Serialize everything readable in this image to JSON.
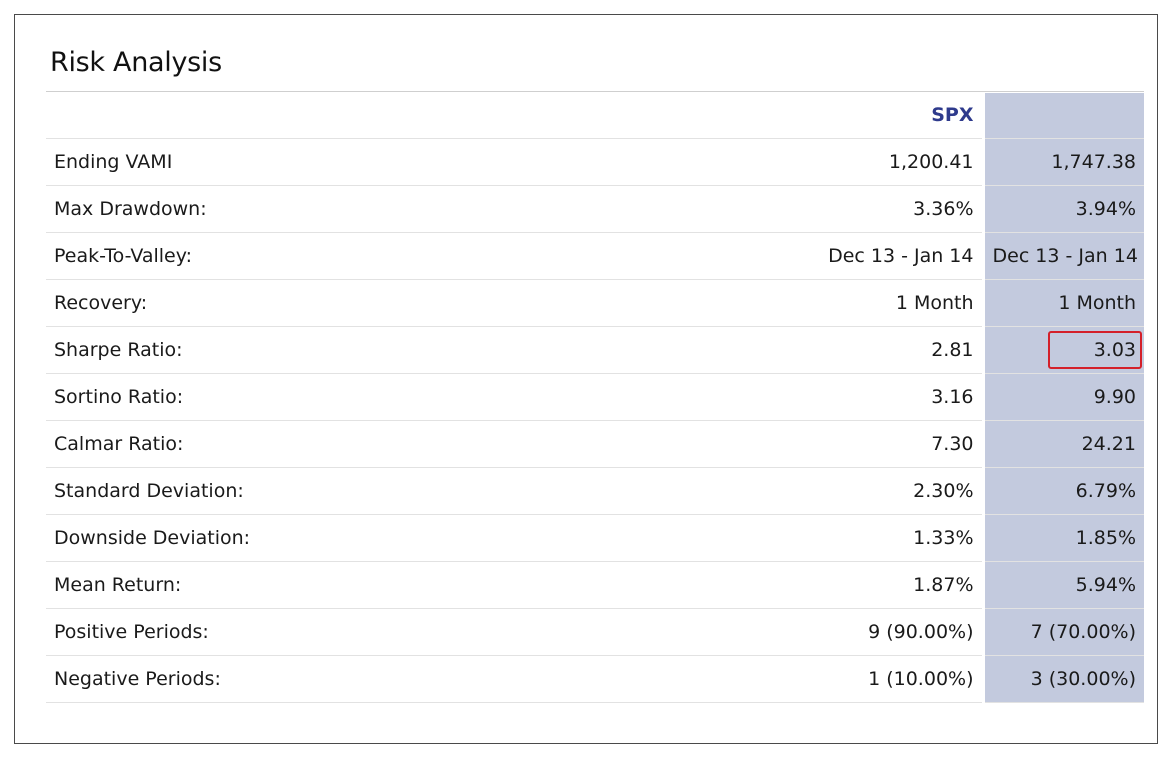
{
  "title": "Risk Analysis",
  "columns": {
    "spx": "SPX",
    "fund": ""
  },
  "rows": [
    {
      "label": "Ending VAMI",
      "spx": "1,200.41",
      "fund": "1,747.38"
    },
    {
      "label": "Max Drawdown:",
      "spx": "3.36%",
      "fund": "3.94%"
    },
    {
      "label": "Peak-To-Valley:",
      "spx": "Dec 13 - Jan 14",
      "fund": "Dec 13 - Jan 14"
    },
    {
      "label": "Recovery:",
      "spx": "1 Month",
      "fund": "1 Month"
    },
    {
      "label": "Sharpe Ratio:",
      "spx": "2.81",
      "fund": "3.03",
      "highlighted": true
    },
    {
      "label": "Sortino Ratio:",
      "spx": "3.16",
      "fund": "9.90"
    },
    {
      "label": "Calmar Ratio:",
      "spx": "7.30",
      "fund": "24.21"
    },
    {
      "label": "Standard Deviation:",
      "spx": "2.30%",
      "fund": "6.79%"
    },
    {
      "label": "Downside Deviation:",
      "spx": "1.33%",
      "fund": "1.85%"
    },
    {
      "label": "Mean Return:",
      "spx": "1.87%",
      "fund": "5.94%"
    },
    {
      "label": "Positive Periods:",
      "spx": "9 (90.00%)",
      "fund": "7 (70.00%)"
    },
    {
      "label": "Negative Periods:",
      "spx": "1 (10.00%)",
      "fund": "3 (30.00%)"
    }
  ],
  "colors": {
    "fund_column_bg": "#c3cade",
    "spx_header": "#2e3a8c",
    "highlight_border": "#d4202a"
  }
}
